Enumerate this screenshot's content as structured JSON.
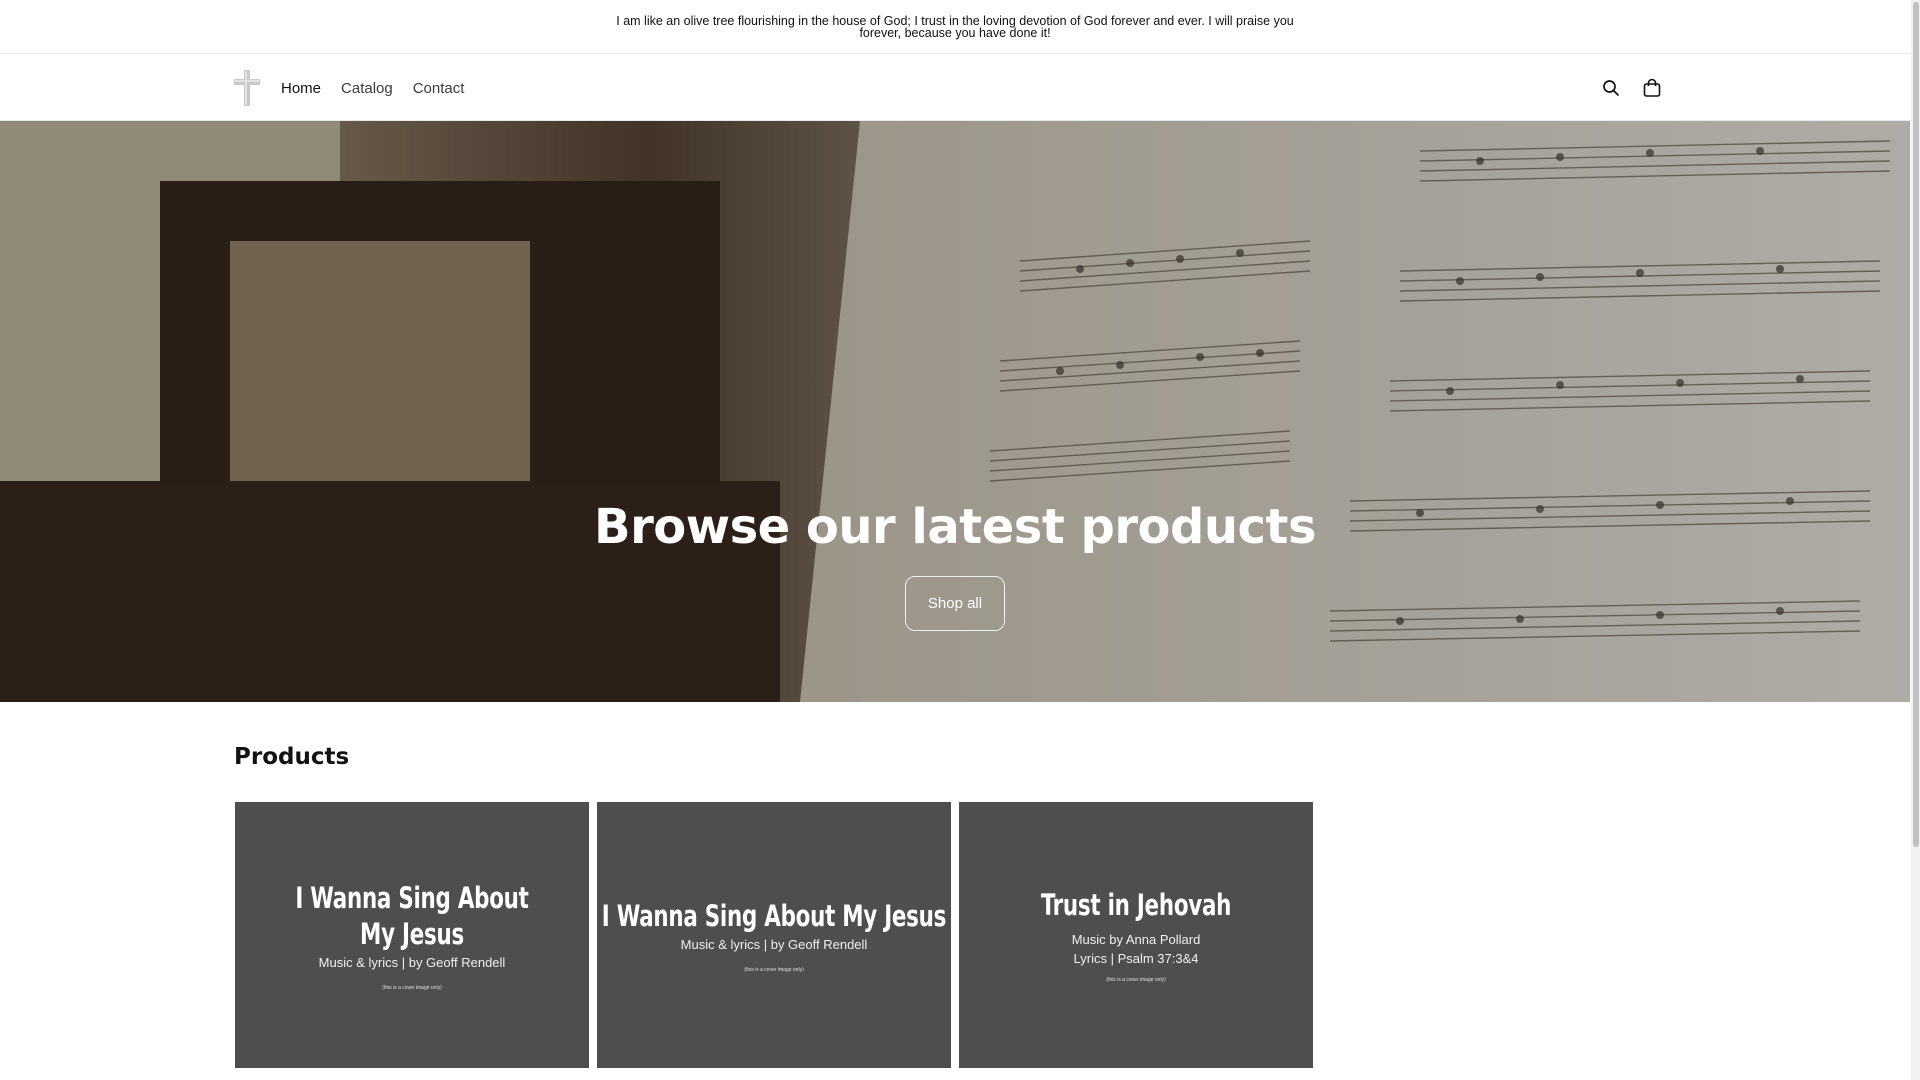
{
  "announcement": {
    "text": "I am like an olive tree flourishing in the house of God; I trust in the loving devotion of God forever and ever. I will praise you forever, because you have done it!"
  },
  "header": {
    "logo_icon": "cross-icon",
    "nav": [
      {
        "label": "Home",
        "active": true
      },
      {
        "label": "Catalog",
        "active": false
      },
      {
        "label": "Contact",
        "active": false
      }
    ],
    "icons": [
      "search-icon",
      "cart-icon"
    ]
  },
  "hero": {
    "title": "Browse our latest products",
    "button_label": "Shop all"
  },
  "products": {
    "heading": "Products",
    "items": [
      {
        "title": "I Wanna Sing About My Jesus",
        "subtitle": "Music & lyrics | by Geoff Rendell",
        "note": "(this is a cover image only)"
      },
      {
        "title": "I Wanna Sing About My Jesus",
        "subtitle": "Music & lyrics | by Geoff Rendell",
        "note": "(this is a cover image only)"
      },
      {
        "title": "Trust in Jehovah",
        "subtitle": "Music by Anna Pollard",
        "subtitle2": "Lyrics | Psalm 37:3&4",
        "note": "(this is a cover image only)"
      }
    ]
  },
  "colors": {
    "card_bg": "#4e4e4e",
    "text": "#121212"
  }
}
